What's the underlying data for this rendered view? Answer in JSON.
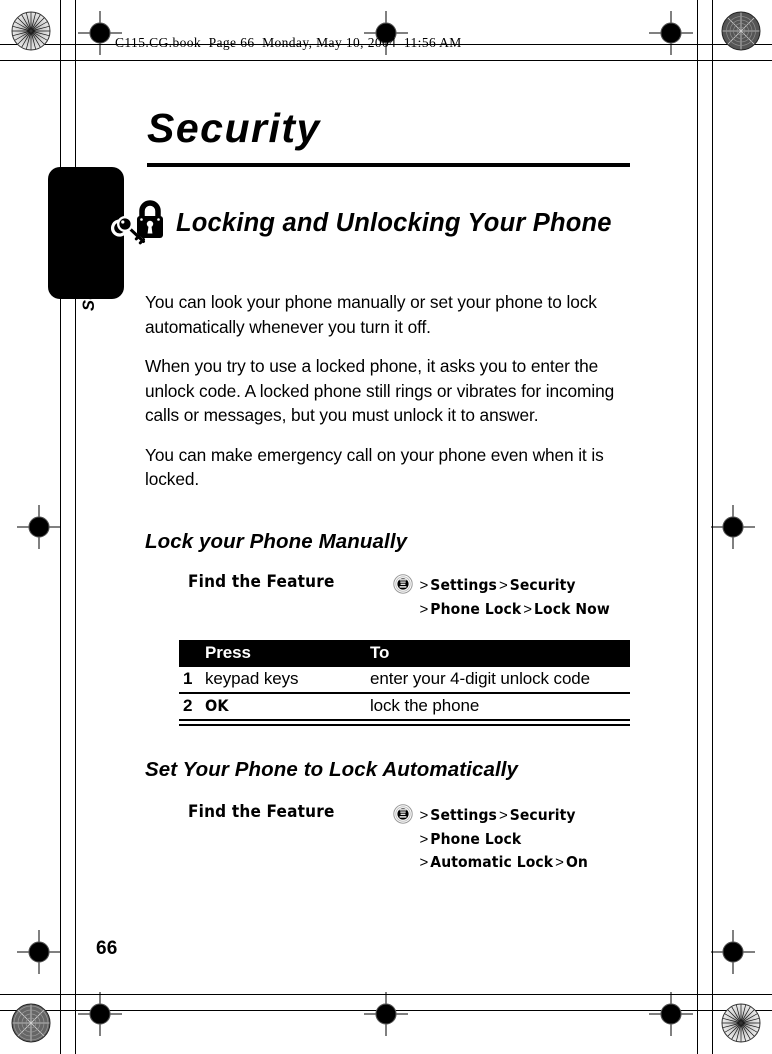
{
  "file_header": "C115.CG.book  Page 66  Monday, May 10, 2004  11:56 AM",
  "chapter": {
    "title": "Security",
    "side_tab_label": "Security"
  },
  "section": {
    "icon": "padlock-key-icon",
    "heading": "Locking and Unlocking Your Phone",
    "paragraphs": [
      "You can look your phone manually or set your phone to lock automatically whenever you turn it off.",
      "When you try to use a locked phone, it asks you to enter the unlock code. A locked phone still rings or vibrates for incoming calls or messages, but you must unlock it to answer.",
      "You can make emergency call on your phone even when it is locked."
    ]
  },
  "subsection_1": {
    "heading": "Lock your Phone Manually",
    "find_the_feature": {
      "label": "Find the Feature",
      "menu_icon": "menu-key-icon",
      "lines": [
        [
          {
            "type": "gt",
            "text": ">"
          },
          {
            "type": "nav",
            "text": "Settings"
          },
          {
            "type": "gt",
            "text": ">"
          },
          {
            "type": "nav",
            "text": "Security"
          }
        ],
        [
          {
            "type": "gt",
            "text": ">"
          },
          {
            "type": "nav",
            "text": "Phone Lock"
          },
          {
            "type": "gt",
            "text": ">"
          },
          {
            "type": "nav",
            "text": "Lock Now"
          }
        ]
      ]
    },
    "table": {
      "headers": [
        "",
        "Press",
        "To"
      ],
      "rows": [
        {
          "num": "1",
          "press": "keypad keys",
          "press_style": "plain",
          "to": "enter your 4-digit unlock code"
        },
        {
          "num": "2",
          "press": "OK",
          "press_style": "key",
          "to": "lock the phone"
        }
      ]
    }
  },
  "subsection_2": {
    "heading": "Set Your Phone to Lock Automatically",
    "find_the_feature": {
      "label": "Find the Feature",
      "menu_icon": "menu-key-icon",
      "lines": [
        [
          {
            "type": "gt",
            "text": ">"
          },
          {
            "type": "nav",
            "text": "Settings"
          },
          {
            "type": "gt",
            "text": ">"
          },
          {
            "type": "nav",
            "text": "Security"
          }
        ],
        [
          {
            "type": "gt",
            "text": ">"
          },
          {
            "type": "nav",
            "text": "Phone Lock"
          }
        ],
        [
          {
            "type": "gt",
            "text": ">"
          },
          {
            "type": "nav",
            "text": "Automatic Lock"
          },
          {
            "type": "gt",
            "text": ">"
          },
          {
            "type": "nav",
            "text": "On"
          }
        ]
      ]
    }
  },
  "footer": {
    "page_number": "66"
  },
  "print_marks": {
    "registration_targets": 8,
    "halftone_targets": 4
  },
  "colors": {
    "ink": "#000000",
    "paper": "#ffffff",
    "table_header_bg": "#000000",
    "table_header_fg": "#ffffff"
  }
}
